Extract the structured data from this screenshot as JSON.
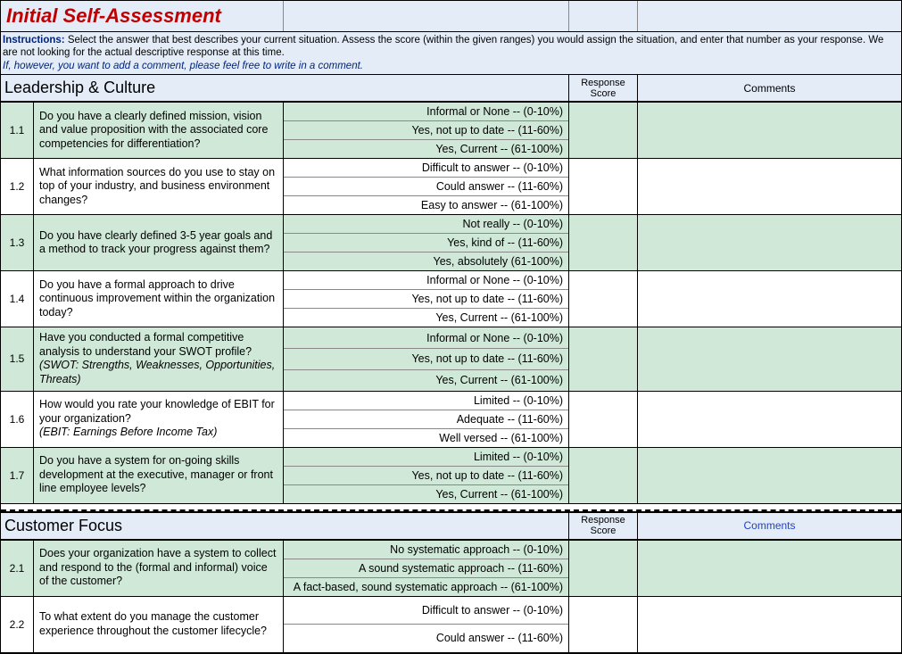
{
  "title": "Initial Self-Assessment",
  "instructions": {
    "label": "Instructions:",
    "body": "Select the answer that best describes your current situation.  Assess the score (within the given ranges) you would assign the situation, and enter that number as your response.  We are not looking for the actual descriptive response at this time.",
    "note": "If, however, you want to add a comment, please feel free to write in a comment."
  },
  "columns": {
    "response1": "Response",
    "response2": "Score",
    "comments": "Comments"
  },
  "sections": [
    {
      "title": "Leadership & Culture",
      "commentsBlue": false,
      "rows": [
        {
          "num": "1.1",
          "shade": "green",
          "q": "Do you have a clearly defined mission, vision and value proposition with the associated core competencies for differentiation?",
          "sub": "",
          "opts": [
            "Informal or None -- (0-10%)",
            "Yes, not up to date -- (11-60%)",
            "Yes, Current -- (61-100%)"
          ]
        },
        {
          "num": "1.2",
          "shade": "white",
          "q": "What information sources do you use to stay on top of your industry, and business environment changes?",
          "sub": "",
          "opts": [
            "Difficult to answer -- (0-10%)",
            "Could answer -- (11-60%)",
            "Easy to answer -- (61-100%)"
          ]
        },
        {
          "num": "1.3",
          "shade": "green",
          "q": "Do you have clearly defined 3-5 year goals and a method to track your progress against them?",
          "sub": "",
          "opts": [
            "Not really -- (0-10%)",
            "Yes, kind of -- (11-60%)",
            "Yes, absolutely (61-100%)"
          ]
        },
        {
          "num": "1.4",
          "shade": "white",
          "q": "Do you have a formal approach to drive continuous improvement within the organization today?",
          "sub": "",
          "opts": [
            "Informal or None -- (0-10%)",
            "Yes, not up to date -- (11-60%)",
            "Yes, Current -- (61-100%)"
          ]
        },
        {
          "num": "1.5",
          "shade": "green",
          "q": "Have you conducted a formal competitive analysis to understand your SWOT profile?",
          "sub": "(SWOT: Strengths, Weaknesses, Opportunities, Threats)",
          "opts": [
            "Informal or None -- (0-10%)",
            "Yes, not up to date -- (11-60%)",
            "Yes, Current -- (61-100%)"
          ]
        },
        {
          "num": "1.6",
          "shade": "white",
          "q": "How would you rate  your knowledge of EBIT for your organization?",
          "sub": "(EBIT: Earnings Before Income Tax)",
          "opts": [
            "Limited -- (0-10%)",
            "Adequate -- (11-60%)",
            "Well versed -- (61-100%)"
          ]
        },
        {
          "num": "1.7",
          "shade": "green",
          "q": "Do you have a system for on-going skills development at the executive, manager or front line employee levels?",
          "sub": "",
          "opts": [
            "Limited -- (0-10%)",
            "Yes, not up to date -- (11-60%)",
            "Yes, Current -- (61-100%)"
          ]
        }
      ]
    },
    {
      "title": "Customer Focus",
      "commentsBlue": true,
      "rows": [
        {
          "num": "2.1",
          "shade": "green",
          "q": "Does your organization have a system to collect and respond to the (formal and informal) voice of the customer?",
          "sub": "",
          "opts": [
            "No systematic approach -- (0-10%)",
            "A sound systematic approach -- (11-60%)",
            "A fact-based, sound systematic approach -- (61-100%)"
          ]
        },
        {
          "num": "2.2",
          "shade": "white",
          "q": "To what extent do you manage the customer experience throughout the customer lifecycle?",
          "sub": "",
          "opts": [
            "Difficult to answer -- (0-10%)",
            "Could answer -- (11-60%)"
          ]
        }
      ]
    }
  ]
}
